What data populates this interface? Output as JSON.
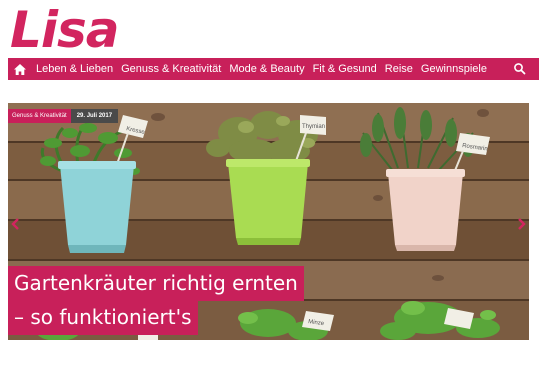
{
  "brand": {
    "logo_text": "Lisa",
    "color": "#d2255f"
  },
  "nav": {
    "bg_color": "#c8205a",
    "home_icon": "house-icon",
    "items": [
      {
        "label": "Leben & Lieben"
      },
      {
        "label": "Genuss & Kreativität"
      },
      {
        "label": "Mode & Beauty"
      },
      {
        "label": "Fit & Gesund"
      },
      {
        "label": "Reise"
      },
      {
        "label": "Gewinnspiele"
      }
    ],
    "search_icon": "search-icon"
  },
  "hero": {
    "category": "Genuss & Kreativität",
    "date": "29. Juli 2017",
    "headline_line1": "Gartenkräuter richtig ernten",
    "headline_line2": "– so funktioniert's",
    "plant_labels": [
      "Kresse",
      "Thymian",
      "Rosmarin",
      "Minze"
    ],
    "prev_icon": "chevron-left-icon",
    "next_icon": "chevron-right-icon"
  }
}
